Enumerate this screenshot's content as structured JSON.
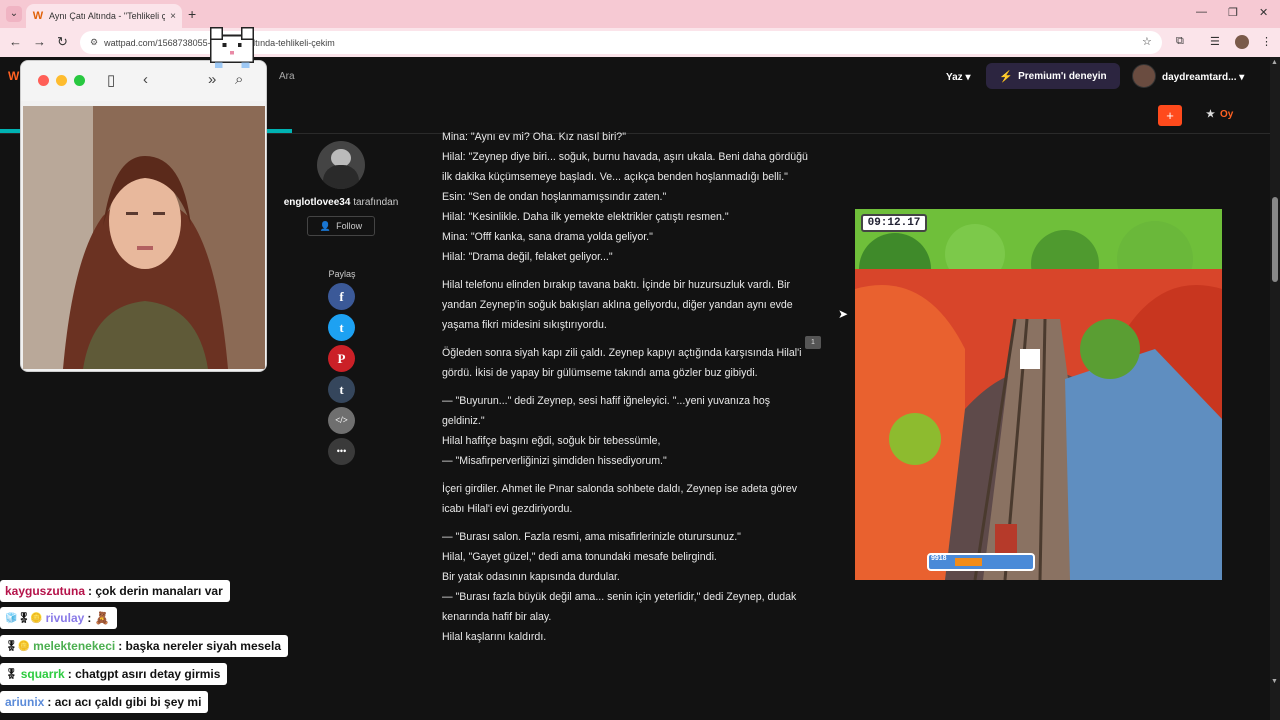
{
  "browser": {
    "tab_title": "Aynı Çatı Altında - \"Tehlikeli çe",
    "tab_close": "×",
    "new_tab": "+",
    "url": "wattpad.com/1568738055-aynı-çatı-altında-tehlikeli-çekim"
  },
  "wattpad": {
    "search_label": "Ara",
    "write_menu": "Yaz ▾",
    "premium_label": "Premium'ı deneyin",
    "username": "daydreamtard... ▾",
    "add_label": "+",
    "vote_label": "Oy",
    "reading_progress_pct": 23
  },
  "author": {
    "name": "englotlovee34",
    "suffix": " tarafından",
    "follow_label": "Follow"
  },
  "share": {
    "label": "Paylaş",
    "buttons": [
      {
        "name": "facebook",
        "glyph": "f",
        "color": "#3b5998"
      },
      {
        "name": "twitter",
        "glyph": "t",
        "color": "#1da1f2"
      },
      {
        "name": "pinterest",
        "glyph": "P",
        "color": "#cb2027"
      },
      {
        "name": "tumblr",
        "glyph": "t",
        "color": "#35465c"
      },
      {
        "name": "embed",
        "glyph": "</>",
        "color": "#6f6f6f"
      },
      {
        "name": "more",
        "glyph": "•••",
        "color": "#3a3a3a"
      }
    ]
  },
  "story": {
    "paragraphs": [
      [
        "Mina: \"Aynı ev mi? Oha. Kız nasıl biri?\"",
        "Hilal: \"Zeynep diye biri... soğuk, burnu havada, aşırı ukala. Beni daha gördüğü ilk dakika küçümsemeye başladı. Ve... açıkça benden hoşlanmadığı belli.\"",
        "Esin: \"Sen de ondan hoşlanmamışsındır zaten.\"",
        "Hilal: \"Kesinlikle. Daha ilk yemekte elektrikler çatıştı resmen.\"",
        "Mina: \"Offf kanka, sana drama yolda geliyor.\"",
        "Hilal: \"Drama değil, felaket geliyor...\""
      ],
      [
        "Hilal telefonu elinden bırakıp tavana baktı. İçinde bir huzursuzluk vardı. Bir yandan Zeynep'in soğuk bakışları aklına geliyordu, diğer yandan aynı evde yaşama fikri midesini sıkıştırıyordu."
      ],
      [
        "Öğleden sonra siyah kapı zili çaldı. Zeynep kapıyı açtığında karşısında Hilal'i gördü. İkisi de yapay bir gülümseme takındı ama gözler buz gibiydi."
      ],
      [
        "— \"Buyurun...\" dedi Zeynep, sesi hafif iğneleyici. \"...yeni yuvanıza hoş geldiniz.\"",
        "Hilal hafifçe başını eğdi, soğuk bir tebessümle,",
        "— \"Misafirperverliğinizi şimdiden hissediyorum.\""
      ],
      [
        "İçeri girdiler. Ahmet ile Pınar salonda sohbete daldı, Zeynep ise adeta görev icabı Hilal'i evi gezdiriyordu."
      ],
      [
        "— \"Burası salon. Fazla resmi, ama misafirlerinizle oturursunuz.\"",
        "Hilal, \"Gayet güzel,\" dedi ama tonundaki mesafe belirgindi.",
        "Bir yatak odasının kapısında durdular.",
        "— \"Burası fazla büyük değil ama... senin için yeterlidir,\" dedi Zeynep, dudak kenarında hafif bir alay.",
        "Hilal kaşlarını kaldırdı."
      ]
    ],
    "comment_count": "1"
  },
  "game": {
    "timer": "09:12.17",
    "meter_score": "9918",
    "meter_fill_pct": 35
  },
  "chat": [
    {
      "user": "kayguszutuna",
      "user_color": "#b5134a",
      "badges": "",
      "text": ": çok derin manaları var"
    },
    {
      "user": "rivulay",
      "user_color": "#8a7be8",
      "badges": "🧊🎖🪙",
      "text": ": 🧸"
    },
    {
      "user": "melektenekeci",
      "user_color": "#4caf50",
      "badges": "🎖🪙",
      "text": ": başka nereler siyah mesela"
    },
    {
      "user": "squarrk",
      "user_color": "#2ecc40",
      "badges": "🎖",
      "text": ": chatgpt asırı detay girmis"
    },
    {
      "user": "ariunix",
      "user_color": "#5b8bd9",
      "badges": "",
      "text": ": acı acı çaldı gibi bi şey mi"
    }
  ]
}
